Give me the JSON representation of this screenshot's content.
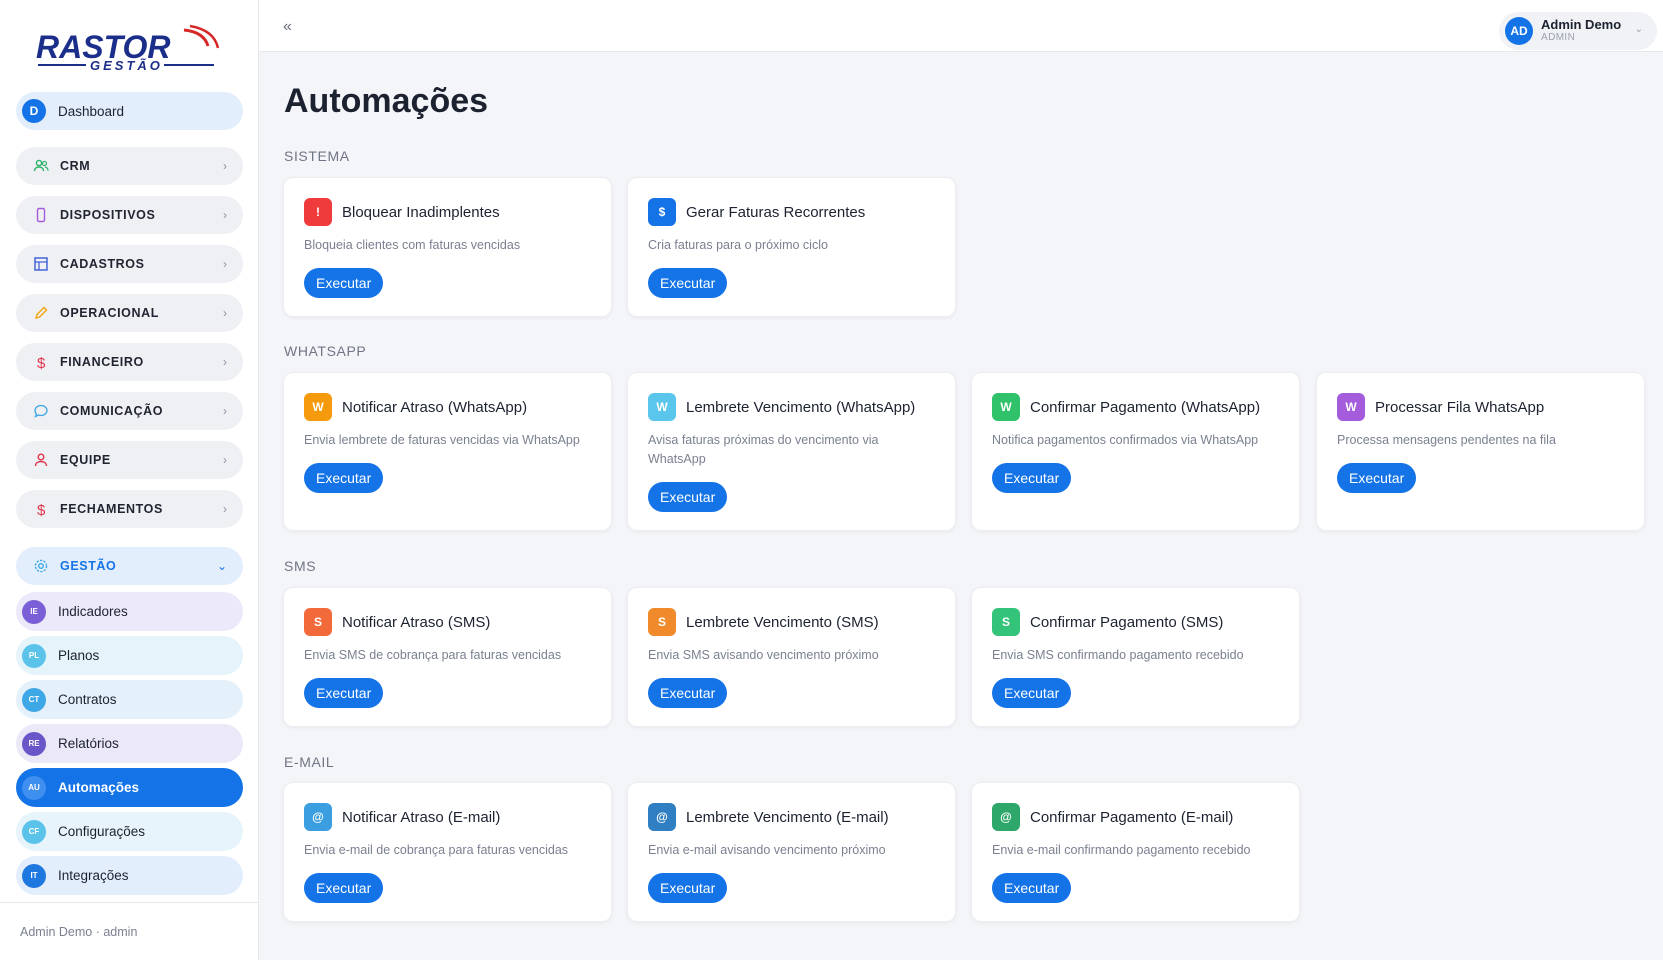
{
  "brand": {
    "logo_text": "RASTOR",
    "logo_sub": "GESTÃO"
  },
  "sidebar": {
    "dashboard": {
      "avatar": "D",
      "label": "Dashboard"
    },
    "groups": [
      {
        "label": "CRM",
        "icon": "users-icon"
      },
      {
        "label": "DISPOSITIVOS",
        "icon": "phone-icon"
      },
      {
        "label": "CADASTROS",
        "icon": "table-icon"
      },
      {
        "label": "OPERACIONAL",
        "icon": "pencil-icon"
      },
      {
        "label": "FINANCEIRO",
        "icon": "dollar-icon"
      },
      {
        "label": "COMUNICAÇÃO",
        "icon": "chat-icon"
      },
      {
        "label": "EQUIPE",
        "icon": "user-icon"
      },
      {
        "label": "FECHAMENTOS",
        "icon": "dollar-icon"
      },
      {
        "label": "GESTÃO",
        "icon": "gear-icon"
      }
    ],
    "chevron_right": "›",
    "chevron_down": "⌄",
    "gestao_items": [
      {
        "abbr": "IE",
        "label": "Indicadores",
        "color": "#7b5fd6",
        "bg": "#ece9fb"
      },
      {
        "abbr": "PL",
        "label": "Planos",
        "color": "#5bc2ea",
        "bg": "#e5f3fb"
      },
      {
        "abbr": "CT",
        "label": "Contratos",
        "color": "#3ea7e6",
        "bg": "#e4f1fb"
      },
      {
        "abbr": "RE",
        "label": "Relatórios",
        "color": "#6a55c9",
        "bg": "#ebe8f8"
      },
      {
        "abbr": "AU",
        "label": "Automações",
        "color": "#3f8ff0",
        "bg": "#1473e6"
      },
      {
        "abbr": "CF",
        "label": "Configurações",
        "color": "#5bc2ea",
        "bg": "#e7f4fb"
      },
      {
        "abbr": "IT",
        "label": "Integrações",
        "color": "#1f78e0",
        "bg": "#e3eefc"
      }
    ],
    "footer": "Admin Demo · admin"
  },
  "topbar": {
    "collapse": "«",
    "user_initials": "AD",
    "user_name": "Admin Demo",
    "user_role": "ADMIN",
    "user_chevron": "⌄"
  },
  "page": {
    "title": "Automações"
  },
  "sections": [
    {
      "label": "SISTEMA",
      "cards": [
        {
          "icon": "!",
          "icon_color": "#ef3b3b",
          "title": "Bloquear Inadimplentes",
          "desc": "Bloqueia clientes com faturas vencidas",
          "button": "Executar"
        },
        {
          "icon": "$",
          "icon_color": "#1473e6",
          "title": "Gerar Faturas Recorrentes",
          "desc": "Cria faturas para o próximo ciclo",
          "button": "Executar"
        }
      ]
    },
    {
      "label": "WHATSAPP",
      "cards": [
        {
          "icon": "W",
          "icon_color": "#f59a0c",
          "title": "Notificar Atraso (WhatsApp)",
          "desc": "Envia lembrete de faturas vencidas via WhatsApp",
          "button": "Executar"
        },
        {
          "icon": "W",
          "icon_color": "#5bc6ec",
          "title": "Lembrete Vencimento (WhatsApp)",
          "desc": "Avisa faturas próximas do vencimento via WhatsApp",
          "button": "Executar"
        },
        {
          "icon": "W",
          "icon_color": "#2fc26a",
          "title": "Confirmar Pagamento (WhatsApp)",
          "desc": "Notifica pagamentos confirmados via WhatsApp",
          "button": "Executar"
        },
        {
          "icon": "W",
          "icon_color": "#a55cdc",
          "title": "Processar Fila WhatsApp",
          "desc": "Processa mensagens pendentes na fila",
          "button": "Executar"
        }
      ]
    },
    {
      "label": "SMS",
      "cards": [
        {
          "icon": "S",
          "icon_color": "#f26a3a",
          "title": "Notificar Atraso (SMS)",
          "desc": "Envia SMS de cobrança para faturas vencidas",
          "button": "Executar"
        },
        {
          "icon": "S",
          "icon_color": "#f08a2a",
          "title": "Lembrete Vencimento (SMS)",
          "desc": "Envia SMS avisando vencimento próximo",
          "button": "Executar"
        },
        {
          "icon": "S",
          "icon_color": "#33c47a",
          "title": "Confirmar Pagamento (SMS)",
          "desc": "Envia SMS confirmando pagamento recebido",
          "button": "Executar"
        }
      ]
    },
    {
      "label": "E-MAIL",
      "cards": [
        {
          "icon": "@",
          "icon_color": "#3a9ee0",
          "title": "Notificar Atraso (E-mail)",
          "desc": "Envia e-mail de cobrança para faturas vencidas",
          "button": "Executar"
        },
        {
          "icon": "@",
          "icon_color": "#2f7fc2",
          "title": "Lembrete Vencimento (E-mail)",
          "desc": "Envia e-mail avisando vencimento próximo",
          "button": "Executar"
        },
        {
          "icon": "@",
          "icon_color": "#2ea86a",
          "title": "Confirmar Pagamento (E-mail)",
          "desc": "Envia e-mail confirmando pagamento recebido",
          "button": "Executar"
        }
      ]
    }
  ]
}
